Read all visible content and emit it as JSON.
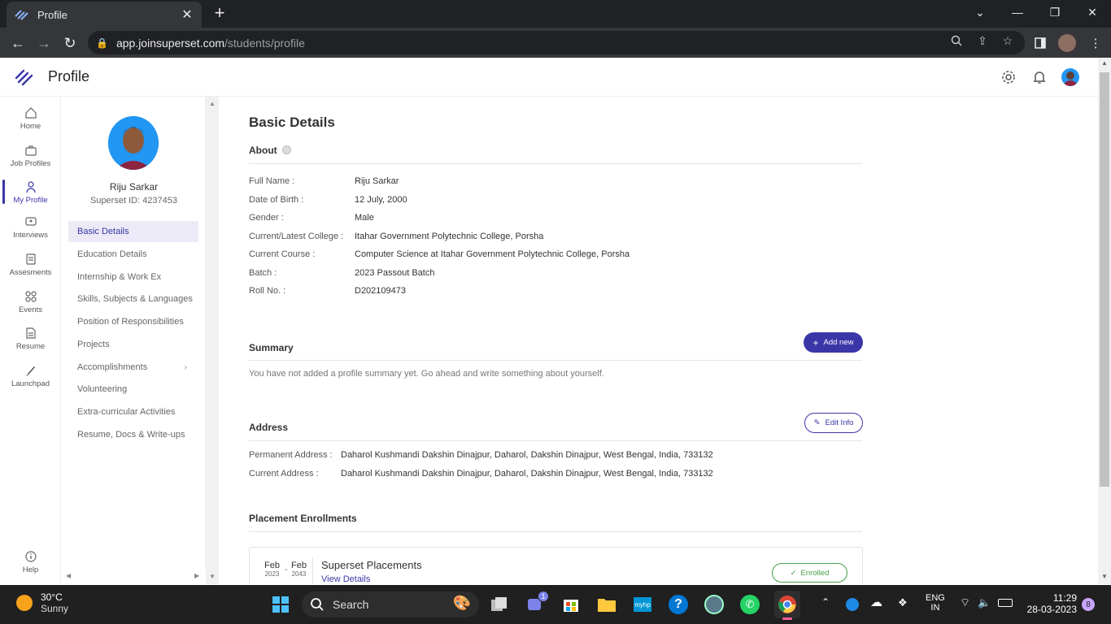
{
  "browser": {
    "tab_title": "Profile",
    "url_host": "app.joinsuperset.com",
    "url_path": "/students/profile"
  },
  "appbar": {
    "title": "Profile"
  },
  "leftnav": {
    "items": [
      {
        "label": "Home",
        "icon": "home-icon"
      },
      {
        "label": "Job Profiles",
        "icon": "briefcase-icon"
      },
      {
        "label": "My Profile",
        "icon": "user-icon"
      },
      {
        "label": "Interviews",
        "icon": "interview-icon"
      },
      {
        "label": "Assesments",
        "icon": "clipboard-icon"
      },
      {
        "label": "Events",
        "icon": "grid-icon"
      },
      {
        "label": "Resume",
        "icon": "document-icon"
      },
      {
        "label": "Launchpad",
        "icon": "rocket-icon"
      }
    ],
    "help": "Help"
  },
  "user": {
    "name": "Riju Sarkar",
    "superset_id": "Superset ID: 4237453"
  },
  "subnav": {
    "items": [
      "Basic Details",
      "Education Details",
      "Internship & Work Ex",
      "Skills, Subjects & Languages",
      "Position of Responsibilities",
      "Projects",
      "Accomplishments",
      "Volunteering",
      "Extra-curricular Activities",
      "Resume, Docs & Write-ups"
    ]
  },
  "basic": {
    "heading": "Basic Details",
    "about_title": "About",
    "fields": [
      {
        "label": "Full Name :",
        "value": "Riju Sarkar"
      },
      {
        "label": "Date of Birth :",
        "value": "12 July, 2000"
      },
      {
        "label": "Gender :",
        "value": "Male"
      },
      {
        "label": "Current/Latest College :",
        "value": "Itahar Government Polytechnic College, Porsha"
      },
      {
        "label": "Current Course :",
        "value": "Computer Science at Itahar Government Polytechnic College, Porsha"
      },
      {
        "label": "Batch :",
        "value": "2023 Passout Batch"
      },
      {
        "label": "Roll No. :",
        "value": "D202109473"
      }
    ]
  },
  "summary": {
    "title": "Summary",
    "add_label": "Add new",
    "empty_text": "You have not added a profile summary yet. Go ahead and write something about yourself."
  },
  "address": {
    "title": "Address",
    "edit_label": "Edit Info",
    "permanent_label": "Permanent Address :",
    "permanent_value": "Daharol Kushmandi Dakshin Dinajpur, Daharol, Dakshin Dinajpur, West Bengal, India, 733132",
    "current_label": "Current Address :",
    "current_value": "Daharol Kushmandi Dakshin Dinajpur, Daharol, Dakshin Dinajpur, West Bengal, India, 733132"
  },
  "placement": {
    "title": "Placement Enrollments",
    "start_month": "Feb",
    "start_year": "2023",
    "end_month": "Feb",
    "end_year": "2043",
    "name": "Superset Placements",
    "link": "View Details",
    "status": "Enrolled"
  },
  "taskbar": {
    "temp": "30°C",
    "weather": "Sunny",
    "search": "Search",
    "lang1": "ENG",
    "lang2": "IN",
    "time": "11:29",
    "date": "28-03-2023",
    "notif_count": "8",
    "teams_badge": "1"
  },
  "colors": {
    "accent": "#3b36a8",
    "enrolled": "#43a047"
  }
}
